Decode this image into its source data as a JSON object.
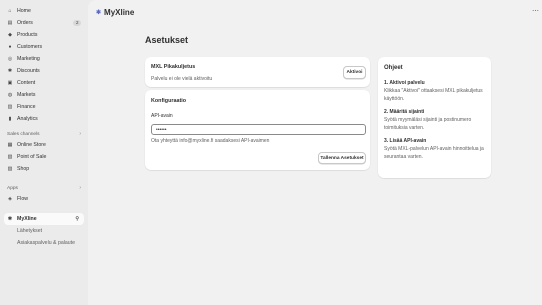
{
  "sidebar": {
    "items": [
      {
        "label": "Home",
        "icon": "home-icon",
        "glyph": "⌂"
      },
      {
        "label": "Orders",
        "icon": "inbox-icon",
        "glyph": "▤",
        "badge": "2"
      },
      {
        "label": "Products",
        "icon": "tag-icon",
        "glyph": "◆"
      },
      {
        "label": "Customers",
        "icon": "person-icon",
        "glyph": "●"
      },
      {
        "label": "Marketing",
        "icon": "target-icon",
        "glyph": "◎"
      },
      {
        "label": "Discounts",
        "icon": "discount-icon",
        "glyph": "✱"
      },
      {
        "label": "Content",
        "icon": "content-icon",
        "glyph": "▣"
      },
      {
        "label": "Markets",
        "icon": "globe-icon",
        "glyph": "◍"
      },
      {
        "label": "Finance",
        "icon": "finance-icon",
        "glyph": "▥"
      },
      {
        "label": "Analytics",
        "icon": "chart-icon",
        "glyph": "▮"
      }
    ],
    "sales_channels_label": "Sales channels",
    "sales_channels": [
      {
        "label": "Online Store",
        "icon": "store-icon",
        "glyph": "▦"
      },
      {
        "label": "Point of Sale",
        "icon": "pos-icon",
        "glyph": "▧"
      },
      {
        "label": "Shop",
        "icon": "shop-icon",
        "glyph": "▨"
      }
    ],
    "apps_label": "Apps",
    "apps": [
      {
        "label": "Flow",
        "icon": "flow-icon",
        "glyph": "◈"
      }
    ],
    "active_app": {
      "label": "MyXline",
      "icon": "app-icon",
      "glyph": "✱",
      "pin_glyph": "⚲"
    },
    "sub_items": [
      "Lähetykset",
      "Asiakaspalvelu & palaute"
    ]
  },
  "header": {
    "app_name": "MyXline",
    "logo_glyph": "✱",
    "more_glyph": "⋯"
  },
  "page": {
    "title": "Asetukset"
  },
  "mxl_card": {
    "title": "MXL Pikakuljetus",
    "status": "Palvelu ei ole vielä aktivoitu",
    "activate_label": "Aktivoi"
  },
  "config_card": {
    "title": "Konfiguraatio",
    "api_label": "API-avain",
    "api_value": "••••••",
    "help_text": "Ota yhteyttä info@myxline.fi saadaksesi API-avaimen",
    "save_label": "Tallenna Asetukset"
  },
  "guide": {
    "title": "Ohjeet",
    "steps": [
      {
        "title": "1. Aktivoi palvelu",
        "text": "Klikkaa \"Aktivoi\" ottaaksesi MXL pikakuljetus käyttöön."
      },
      {
        "title": "2. Määritä sijainti",
        "text": "Syötä myymäläsi sijainti ja postinumero toimituksia varten."
      },
      {
        "title": "3. Lisää API-avain",
        "text": "Syötä MXL-palvelun API-avain hinnoittelua ja seurantaa varten."
      }
    ]
  }
}
